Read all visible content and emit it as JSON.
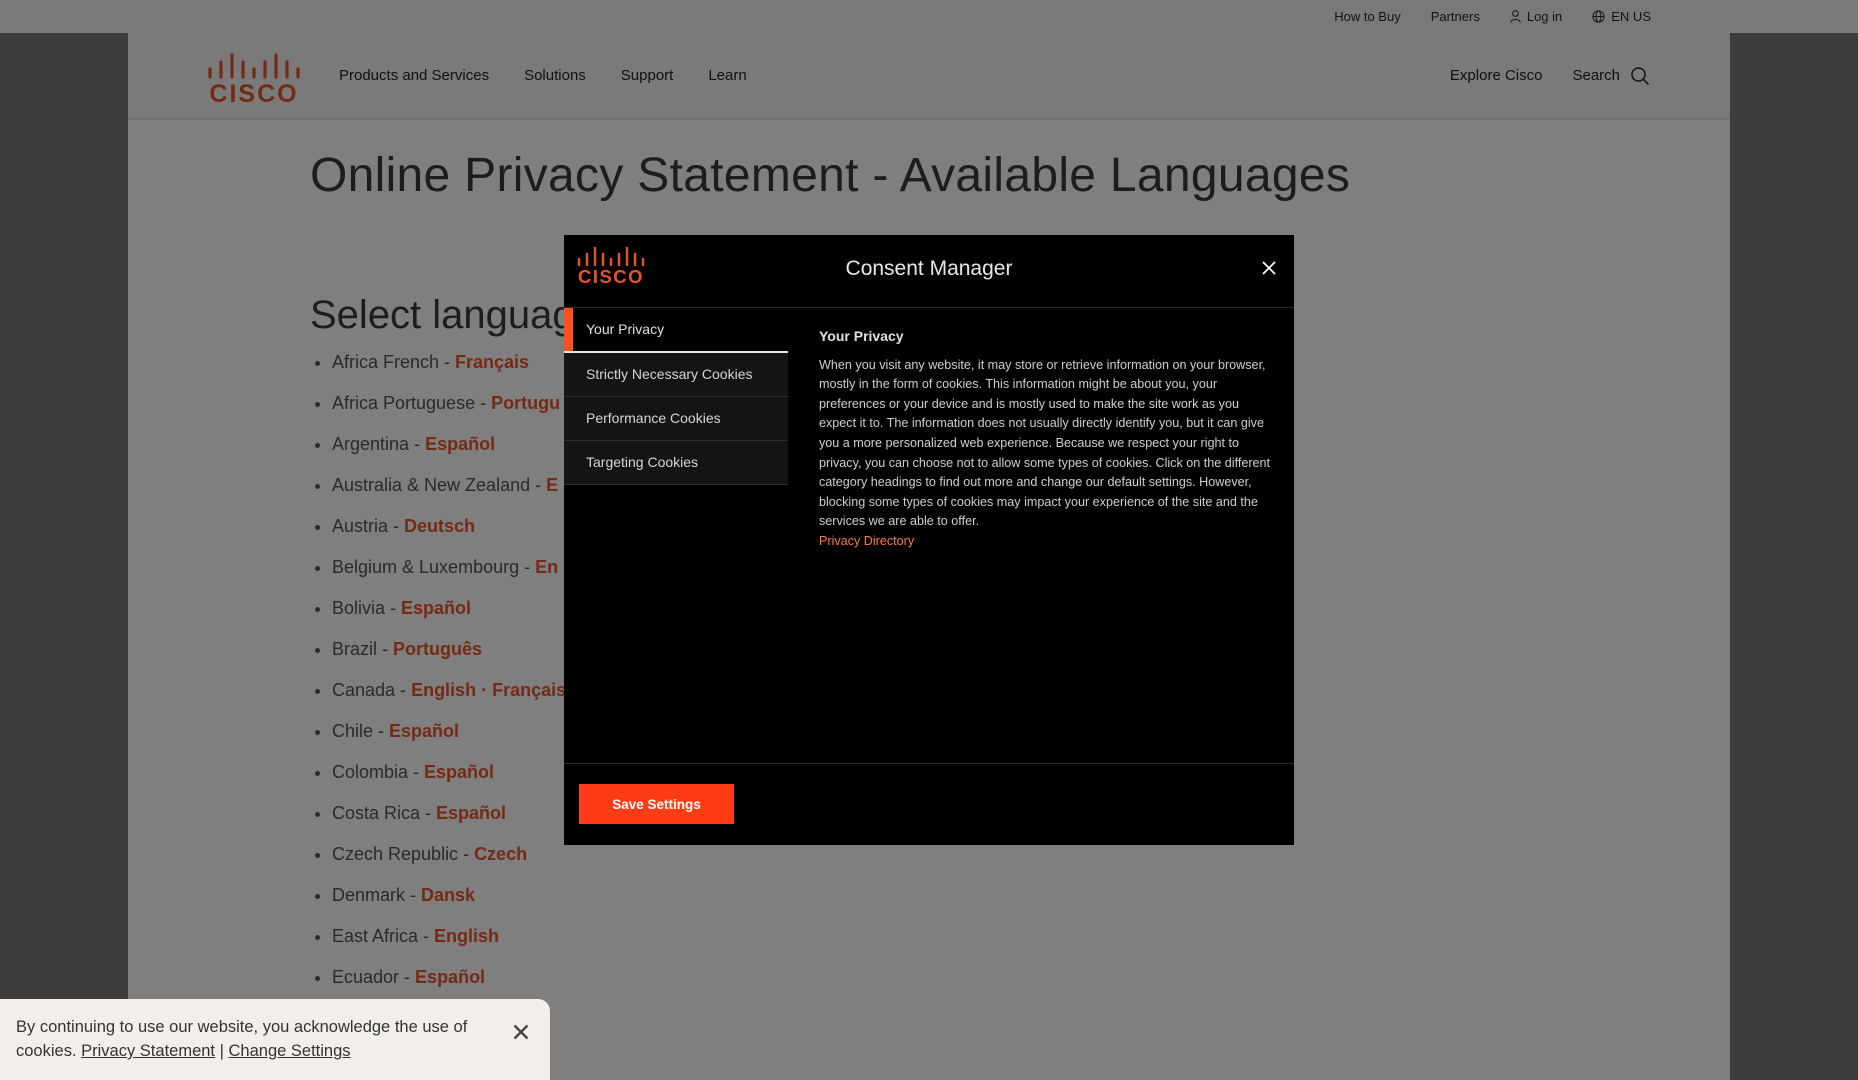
{
  "utility": {
    "how_to_buy": "How to Buy",
    "partners": "Partners",
    "login": "Log in",
    "locale": "EN US"
  },
  "nav": {
    "logo_text": "CISCO",
    "items": [
      "Products and Services",
      "Solutions",
      "Support",
      "Learn"
    ],
    "explore": "Explore Cisco",
    "search": "Search"
  },
  "page": {
    "title": "Online Privacy Statement - Available Languages",
    "select_heading": "Select languag",
    "languages": [
      {
        "region": "Africa French - ",
        "links": [
          "Français"
        ]
      },
      {
        "region": "Africa Portuguese - ",
        "links": [
          "Portugu"
        ]
      },
      {
        "region": "Argentina - ",
        "links": [
          "Español"
        ]
      },
      {
        "region": "Australia & New Zealand - ",
        "links": [
          "E"
        ]
      },
      {
        "region": "Austria - ",
        "links": [
          "Deutsch"
        ]
      },
      {
        "region": "Belgium & Luxembourg - ",
        "links": [
          "En"
        ]
      },
      {
        "region": "Bolivia - ",
        "links": [
          "Español"
        ]
      },
      {
        "region": "Brazil - ",
        "links": [
          "Português"
        ]
      },
      {
        "region": "Canada - ",
        "links": [
          "English",
          "Français"
        ]
      },
      {
        "region": "Chile - ",
        "links": [
          "Español"
        ]
      },
      {
        "region": "Colombia - ",
        "links": [
          "Español"
        ]
      },
      {
        "region": "Costa Rica - ",
        "links": [
          "Español"
        ]
      },
      {
        "region": "Czech Republic - ",
        "links": [
          "Czech"
        ]
      },
      {
        "region": "Denmark - ",
        "links": [
          "Dansk"
        ]
      },
      {
        "region": "East Africa - ",
        "links": [
          "English"
        ]
      },
      {
        "region": "Ecuador - ",
        "links": [
          "Español"
        ]
      }
    ]
  },
  "modal": {
    "logo_text": "CISCO",
    "title": "Consent Manager",
    "tabs": [
      {
        "label": "Your Privacy",
        "active": true
      },
      {
        "label": "Strictly Necessary Cookies",
        "active": false
      },
      {
        "label": "Performance Cookies",
        "active": false
      },
      {
        "label": "Targeting Cookies",
        "active": false
      }
    ],
    "panel_heading": "Your Privacy",
    "panel_body": "When you visit any website, it may store or retrieve information on your browser, mostly in the form of cookies. This information might be about you, your preferences or your device and is mostly used to make the site work as you expect it to. The information does not usually directly identify you, but it can give you a more personalized web experience. Because we respect your right to privacy, you can choose not to allow some types of cookies. Click on the different category headings to find out more and change our default settings. However, blocking some types of cookies may impact your experience of the site and the services we are able to offer.",
    "panel_link": "Privacy Directory",
    "save_button": "Save Settings"
  },
  "cookie_bar": {
    "text": "By continuing to use our website, you acknowledge the use of cookies.",
    "privacy_link": "Privacy Statement",
    "separator": "|",
    "change_link": "Change Settings"
  },
  "colors": {
    "accent": "#ff3c16",
    "link": "#e8542a",
    "modal_bg": "#000000"
  }
}
